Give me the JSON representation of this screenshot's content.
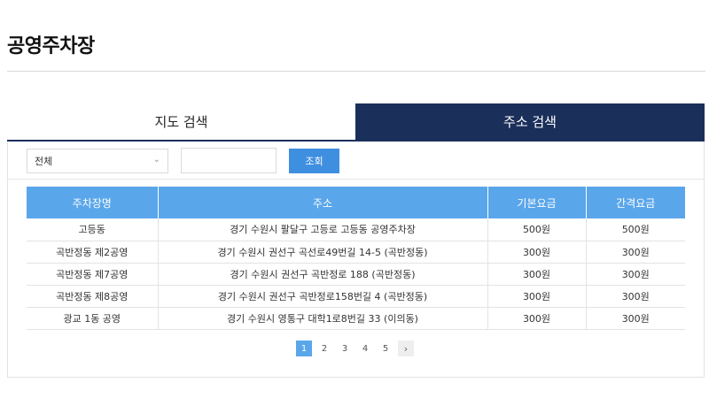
{
  "page": {
    "title": "공영주차장"
  },
  "tabs": [
    {
      "label": "지도 검색",
      "active": false
    },
    {
      "label": "주소 검색",
      "active": true
    }
  ],
  "filter": {
    "region_selected": "전체",
    "keyword_value": "",
    "keyword_placeholder": "",
    "search_label": "조회"
  },
  "table": {
    "headers": [
      "주차장명",
      "주소",
      "기본요금",
      "간격요금"
    ],
    "rows": [
      [
        "고등동",
        "경기 수원시 팔달구 고등로 고등동 공영주차장",
        "500원",
        "500원"
      ],
      [
        "곡반정동 제2공영",
        "경기 수원시 권선구 곡선로49번길 14-5 (곡반정동)",
        "300원",
        "300원"
      ],
      [
        "곡반정동 제7공영",
        "경기 수원시 권선구 곡반정로 188 (곡반정동)",
        "300원",
        "300원"
      ],
      [
        "곡반정동 제8공영",
        "경기 수원시 권선구 곡반정로158번길 4 (곡반정동)",
        "300원",
        "300원"
      ],
      [
        "광교 1동 공영",
        "경기 수원시 영통구 대학1로8번길 33 (이의동)",
        "300원",
        "300원"
      ]
    ]
  },
  "pagination": {
    "pages": [
      "1",
      "2",
      "3",
      "4",
      "5"
    ],
    "current": "1",
    "next_icon": "chevron-right-icon"
  },
  "colors": {
    "active_tab": "#1b2f5b",
    "table_header": "#5aa6ea",
    "search_button": "#3f8fe0"
  }
}
